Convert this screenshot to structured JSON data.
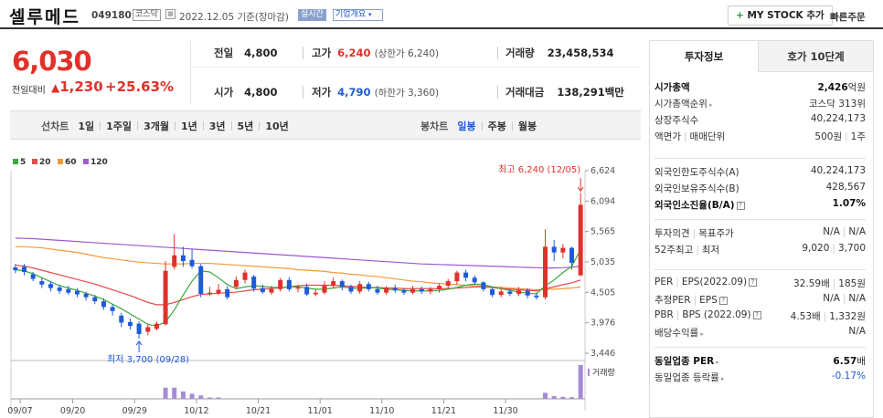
{
  "header": {
    "name": "셀루메드",
    "code": "049180",
    "market": "코스닥",
    "date_text": "2022.12.05 기준(장마감)",
    "realtime": "실시간",
    "company_info": "기업개요",
    "my_stock": "MY STOCK 추가",
    "quick_order": "빠른주문"
  },
  "quote": {
    "price": "6,030",
    "change_label": "전일대비",
    "change": "1,230",
    "rate": "+25.63%",
    "prev_close_label": "전일",
    "prev_close": "4,800",
    "open_label": "시가",
    "open": "4,800",
    "high_label": "고가",
    "high": "6,240",
    "upper_limit": "(상한가 6,240)",
    "low_label": "저가",
    "low": "4,790",
    "lower_limit": "(하한가 3,360)",
    "volume_label": "거래량",
    "volume": "23,458,534",
    "amount_label": "거래대금",
    "amount": "138,291",
    "amount_unit": "백만"
  },
  "periods": {
    "label": "선차트",
    "items": [
      "1일",
      "1주일",
      "3개월",
      "1년",
      "3년",
      "5년",
      "10년"
    ],
    "candle_label": "봉차트",
    "candle_items": [
      "일봉",
      "주봉",
      "월봉"
    ],
    "active_candle": "일봉"
  },
  "colors": {
    "up": "#e0312a",
    "down": "#1e5bd6",
    "ma5": "#3aa93a",
    "ma20": "#e54a4a",
    "ma60": "#f39a3a",
    "ma120": "#9a5ad0",
    "volume": "#a78ad8"
  },
  "chart_data": {
    "type": "candlestick",
    "legend": [
      "5",
      "20",
      "60",
      "120"
    ],
    "x_ticks": [
      "09/07",
      "09/20",
      "09/29",
      "10/12",
      "10/21",
      "11/01",
      "11/10",
      "11/21",
      "11/30"
    ],
    "y_ticks": [
      "6,624",
      "6,094",
      "5,565",
      "5,035",
      "4,505",
      "3,976",
      "3,446"
    ],
    "ylim": [
      3446,
      6624
    ],
    "high_annotation": "최고 6,240 (12/05)",
    "low_annotation": "최저 3,700 (09/28)",
    "volume_label": "거래량",
    "candles": [
      {
        "o": 4940,
        "c": 4890,
        "h": 5000,
        "l": 4840,
        "v": 0
      },
      {
        "o": 4950,
        "c": 4860,
        "h": 5000,
        "l": 4800,
        "v": 0
      },
      {
        "o": 4820,
        "c": 4740,
        "h": 4860,
        "l": 4700,
        "v": 0
      },
      {
        "o": 4700,
        "c": 4640,
        "h": 4750,
        "l": 4580,
        "v": 0
      },
      {
        "o": 4650,
        "c": 4580,
        "h": 4700,
        "l": 4520,
        "v": 0
      },
      {
        "o": 4590,
        "c": 4530,
        "h": 4640,
        "l": 4480,
        "v": 0
      },
      {
        "o": 4560,
        "c": 4500,
        "h": 4620,
        "l": 4460,
        "v": 0
      },
      {
        "o": 4530,
        "c": 4470,
        "h": 4580,
        "l": 4420,
        "v": 0
      },
      {
        "o": 4480,
        "c": 4420,
        "h": 4520,
        "l": 4360,
        "v": 0
      },
      {
        "o": 4420,
        "c": 4350,
        "h": 4460,
        "l": 4300,
        "v": 0
      },
      {
        "o": 4350,
        "c": 4250,
        "h": 4400,
        "l": 4200,
        "v": 0
      },
      {
        "o": 4250,
        "c": 4180,
        "h": 4300,
        "l": 4100,
        "v": 0
      },
      {
        "o": 4100,
        "c": 3980,
        "h": 4150,
        "l": 3900,
        "v": 0
      },
      {
        "o": 3990,
        "c": 3920,
        "h": 4050,
        "l": 3860,
        "v": 0
      },
      {
        "o": 3960,
        "c": 3780,
        "h": 4000,
        "l": 3700,
        "v": 0
      },
      {
        "o": 3820,
        "c": 3900,
        "h": 3960,
        "l": 3760,
        "v": 0
      },
      {
        "o": 3870,
        "c": 3960,
        "h": 4000,
        "l": 3840,
        "v": 0
      },
      {
        "o": 3950,
        "c": 4880,
        "h": 5050,
        "l": 3930,
        "v": 0.33
      },
      {
        "o": 4950,
        "c": 5150,
        "h": 5520,
        "l": 4900,
        "v": 0.33
      },
      {
        "o": 5150,
        "c": 5050,
        "h": 5300,
        "l": 4950,
        "v": 0.22
      },
      {
        "o": 5070,
        "c": 4960,
        "h": 5250,
        "l": 4920,
        "v": 0.15
      },
      {
        "o": 4960,
        "c": 4480,
        "h": 5000,
        "l": 4420,
        "v": 0.1
      },
      {
        "o": 4470,
        "c": 4500,
        "h": 4600,
        "l": 4440,
        "v": 0.04
      },
      {
        "o": 4490,
        "c": 4550,
        "h": 4650,
        "l": 4460,
        "v": 0.04
      },
      {
        "o": 4560,
        "c": 4420,
        "h": 4610,
        "l": 4380,
        "v": 0
      },
      {
        "o": 4600,
        "c": 4720,
        "h": 4780,
        "l": 4560,
        "v": 0
      },
      {
        "o": 4720,
        "c": 4850,
        "h": 4900,
        "l": 4660,
        "v": 0
      },
      {
        "o": 4780,
        "c": 4570,
        "h": 4810,
        "l": 4520,
        "v": 0
      },
      {
        "o": 4580,
        "c": 4510,
        "h": 4640,
        "l": 4480,
        "v": 0
      },
      {
        "o": 4500,
        "c": 4560,
        "h": 4620,
        "l": 4460,
        "v": 0
      },
      {
        "o": 4560,
        "c": 4720,
        "h": 4760,
        "l": 4520,
        "v": 0
      },
      {
        "o": 4720,
        "c": 4560,
        "h": 4770,
        "l": 4520,
        "v": 0
      },
      {
        "o": 4570,
        "c": 4590,
        "h": 4640,
        "l": 4500,
        "v": 0
      },
      {
        "o": 4600,
        "c": 4470,
        "h": 4660,
        "l": 4440,
        "v": 0
      },
      {
        "o": 4470,
        "c": 4500,
        "h": 4560,
        "l": 4440,
        "v": 0
      },
      {
        "o": 4500,
        "c": 4620,
        "h": 4700,
        "l": 4470,
        "v": 0
      },
      {
        "o": 4620,
        "c": 4700,
        "h": 4760,
        "l": 4580,
        "v": 0
      },
      {
        "o": 4700,
        "c": 4600,
        "h": 4730,
        "l": 4540,
        "v": 0
      },
      {
        "o": 4600,
        "c": 4520,
        "h": 4640,
        "l": 4480,
        "v": 0
      },
      {
        "o": 4520,
        "c": 4650,
        "h": 4700,
        "l": 4480,
        "v": 0
      },
      {
        "o": 4650,
        "c": 4560,
        "h": 4690,
        "l": 4520,
        "v": 0
      },
      {
        "o": 4560,
        "c": 4500,
        "h": 4620,
        "l": 4460,
        "v": 0
      },
      {
        "o": 4500,
        "c": 4580,
        "h": 4620,
        "l": 4460,
        "v": 0
      },
      {
        "o": 4580,
        "c": 4540,
        "h": 4640,
        "l": 4500,
        "v": 0
      },
      {
        "o": 4540,
        "c": 4500,
        "h": 4580,
        "l": 4460,
        "v": 0
      },
      {
        "o": 4500,
        "c": 4560,
        "h": 4620,
        "l": 4470,
        "v": 0
      },
      {
        "o": 4560,
        "c": 4520,
        "h": 4610,
        "l": 4480,
        "v": 0
      },
      {
        "o": 4520,
        "c": 4560,
        "h": 4600,
        "l": 4470,
        "v": 0
      },
      {
        "o": 4560,
        "c": 4620,
        "h": 4660,
        "l": 4500,
        "v": 0
      },
      {
        "o": 4620,
        "c": 4700,
        "h": 4740,
        "l": 4560,
        "v": 0
      },
      {
        "o": 4700,
        "c": 4850,
        "h": 4880,
        "l": 4640,
        "v": 0
      },
      {
        "o": 4850,
        "c": 4760,
        "h": 4900,
        "l": 4700,
        "v": 0
      },
      {
        "o": 4760,
        "c": 4680,
        "h": 4800,
        "l": 4640,
        "v": 0
      },
      {
        "o": 4680,
        "c": 4560,
        "h": 4700,
        "l": 4520,
        "v": 0
      },
      {
        "o": 4560,
        "c": 4460,
        "h": 4600,
        "l": 4420,
        "v": 0
      },
      {
        "o": 4460,
        "c": 4520,
        "h": 4600,
        "l": 4420,
        "v": 0
      },
      {
        "o": 4520,
        "c": 4480,
        "h": 4560,
        "l": 4440,
        "v": 0
      },
      {
        "o": 4480,
        "c": 4540,
        "h": 4600,
        "l": 4440,
        "v": 0
      },
      {
        "o": 4540,
        "c": 4450,
        "h": 4580,
        "l": 4400,
        "v": 0
      },
      {
        "o": 4450,
        "c": 4420,
        "h": 4500,
        "l": 4380,
        "v": 0
      },
      {
        "o": 4420,
        "c": 5300,
        "h": 5600,
        "l": 4380,
        "v": 0.18
      },
      {
        "o": 5300,
        "c": 5200,
        "h": 5420,
        "l": 5050,
        "v": 0.08
      },
      {
        "o": 5200,
        "c": 5280,
        "h": 5350,
        "l": 5100,
        "v": 0.06
      },
      {
        "o": 5280,
        "c": 5020,
        "h": 5300,
        "l": 4900,
        "v": 0.05
      },
      {
        "o": 4800,
        "c": 6030,
        "h": 6240,
        "l": 4790,
        "v": 1
      }
    ],
    "ma": {
      "ma5": [
        4900,
        4880,
        4830,
        4760,
        4690,
        4620,
        4580,
        4540,
        4490,
        4440,
        4380,
        4300,
        4220,
        4130,
        4040,
        3950,
        3920,
        3990,
        4200,
        4460,
        4700,
        4880,
        4860,
        4760,
        4640,
        4570,
        4600,
        4620,
        4610,
        4590,
        4590,
        4600,
        4600,
        4580,
        4560,
        4560,
        4580,
        4600,
        4580,
        4570,
        4590,
        4580,
        4560,
        4550,
        4540,
        4530,
        4530,
        4530,
        4540,
        4560,
        4590,
        4630,
        4650,
        4640,
        4600,
        4570,
        4540,
        4510,
        4490,
        4480,
        4620,
        4720,
        4850,
        4960,
        5250
      ],
      "ma20": [
        4980,
        4960,
        4930,
        4890,
        4850,
        4810,
        4770,
        4730,
        4690,
        4650,
        4600,
        4550,
        4500,
        4450,
        4390,
        4330,
        4290,
        4290,
        4330,
        4380,
        4430,
        4470,
        4480,
        4490,
        4500,
        4510,
        4530,
        4550,
        4560,
        4570,
        4590,
        4600,
        4620,
        4630,
        4630,
        4630,
        4630,
        4620,
        4610,
        4600,
        4590,
        4590,
        4580,
        4580,
        4570,
        4570,
        4570,
        4570,
        4570,
        4570,
        4580,
        4590,
        4600,
        4600,
        4590,
        4570,
        4560,
        4550,
        4540,
        4530,
        4570,
        4600,
        4640,
        4670,
        4720
      ],
      "ma60": [
        5300,
        5300,
        5290,
        5280,
        5260,
        5240,
        5220,
        5200,
        5170,
        5140,
        5110,
        5090,
        5070,
        5050,
        5030,
        5020,
        5010,
        5000,
        5000,
        5000,
        5010,
        5010,
        5010,
        5000,
        4990,
        4980,
        4970,
        4960,
        4950,
        4940,
        4930,
        4920,
        4900,
        4890,
        4880,
        4870,
        4850,
        4840,
        4820,
        4810,
        4790,
        4780,
        4760,
        4740,
        4720,
        4700,
        4690,
        4670,
        4660,
        4650,
        4640,
        4630,
        4620,
        4610,
        4600,
        4590,
        4580,
        4570,
        4560,
        4550,
        4560,
        4560,
        4570,
        4580,
        4600
      ],
      "ma120": [
        5450,
        5445,
        5440,
        5430,
        5420,
        5410,
        5400,
        5390,
        5380,
        5370,
        5360,
        5350,
        5340,
        5330,
        5320,
        5310,
        5300,
        5290,
        5280,
        5270,
        5260,
        5250,
        5240,
        5230,
        5220,
        5210,
        5200,
        5190,
        5180,
        5170,
        5160,
        5150,
        5140,
        5130,
        5120,
        5110,
        5100,
        5090,
        5080,
        5070,
        5060,
        5050,
        5040,
        5030,
        5020,
        5010,
        5000,
        4995,
        4990,
        4985,
        4980,
        4975,
        4970,
        4965,
        4960,
        4955,
        4950,
        4945,
        4940,
        4935,
        4930,
        4930,
        4935,
        4945,
        4960
      ]
    }
  },
  "tabs": [
    "투자정보",
    "호가 10단계"
  ],
  "info": {
    "g1": [
      {
        "k": "시가총액",
        "v": "2,426",
        "u": "억원"
      },
      {
        "k": "시가총액순위",
        "v": "코스닥 313위"
      },
      {
        "k": "상장주식수",
        "v": "40,224,173"
      },
      {
        "k": "액면가",
        "k2": "매매단위",
        "v": "500원",
        "v2": "1주"
      }
    ],
    "g2": [
      {
        "k": "외국인한도주식수(A)",
        "v": "40,224,173"
      },
      {
        "k": "외국인보유주식수(B)",
        "v": "428,567"
      },
      {
        "k": "외국인소진율(B/A)",
        "v": "1.07%"
      }
    ],
    "g3": [
      {
        "k": "투자의견",
        "k2": "목표주가",
        "v": "N/A",
        "v2": "N/A"
      },
      {
        "k": "52주최고",
        "k2": "최저",
        "v": "9,020",
        "v2": "3,700"
      }
    ],
    "g4": [
      {
        "k": "PER",
        "k2": "EPS(2022.09)",
        "v": "32.59배",
        "v2": "185원"
      },
      {
        "k": "추정PER",
        "k2": "EPS",
        "v": "N/A",
        "v2": "N/A"
      },
      {
        "k": "PBR",
        "k2": "BPS (2022.09)",
        "v": "4.53배",
        "v2": "1,332원"
      },
      {
        "k": "배당수익률",
        "v": "N/A"
      }
    ],
    "g5": [
      {
        "k": "동일업종 PER",
        "v": "6.57",
        "u": "배"
      },
      {
        "k": "동일업종 등락률",
        "v": "-0.17%"
      }
    ]
  }
}
